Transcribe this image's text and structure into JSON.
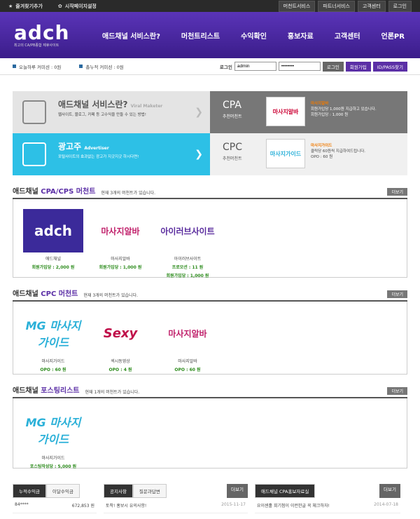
{
  "top": {
    "left": [
      "즐겨찾기추가",
      "시작페이지설정"
    ],
    "right": [
      "머천트서비스",
      "파트너서비스",
      "고객센터",
      "로그인"
    ]
  },
  "logo": {
    "name": "adch",
    "tag": "최고의 CA/PB종합 제휴사이트"
  },
  "menu": [
    "애드채널 서비스란?",
    "머천트리스트",
    "수익확인",
    "홍보자료",
    "고객센터",
    "언론PR"
  ],
  "login": {
    "stat1": "오늘하루 커미션 : 0원",
    "stat2": "총누적 커미션 : 0원",
    "label": "로그인",
    "id": "admin",
    "pw": "••••••••",
    "btn": "로그인",
    "join": "회원가입",
    "find": "ID/PASS찾기"
  },
  "banner": {
    "b1": {
      "title": "애드채널 서비스란?",
      "sub": "Viral Maketer",
      "desc": "웹사이트, 블로그, 카페 등 고수익을 만들 수 있는 방법!"
    },
    "b2": {
      "title": "CPA",
      "sub": "추천머천트",
      "name": "마사지알바",
      "line": "회원가입당 1,000원 지급하고 있습니다.",
      "val": "회원가입당 : 1,000 원"
    },
    "b3": {
      "title": "광고주",
      "sub": "Advertiser",
      "desc": "포털사이트의 효과없는 광고가 지긋지긋 하시다면!"
    },
    "b4": {
      "title": "CPC",
      "sub": "추천머천트",
      "name": "마사지가이드",
      "line": "클릭당 60원씩 지급하여드립니다.",
      "val": "OPO : 60 원"
    }
  },
  "sections": [
    {
      "pre": "애드채널",
      "hl": "CPA/CPS 머천트",
      "cnt": "현재 3개의 머천트가 있습니다.",
      "more": "더보기",
      "items": [
        {
          "img": "adch",
          "txt": "adch",
          "nm": "애드채널",
          "v": [
            "회원가입당 : 2,000 원"
          ]
        },
        {
          "img": "pink",
          "txt": "마사지알바",
          "nm": "마사지알바",
          "v": [
            "회원가입당 : 1,000 원"
          ]
        },
        {
          "img": "iner",
          "txt": "아이러브사이트",
          "nm": "아이러브사이트",
          "v": [
            "프로모션 : 11 원",
            "회원가입당 : 1,000 원"
          ]
        }
      ]
    },
    {
      "pre": "애드채널",
      "hl": "CPC 머천트",
      "cnt": "현재 3개의 머천트가 있습니다.",
      "more": "더보기",
      "items": [
        {
          "img": "mg",
          "txt": "MG 마사지가이드",
          "nm": "마사지가이드",
          "v": [
            "OPO : 60 원"
          ]
        },
        {
          "img": "sexy",
          "txt": "Sexy",
          "nm": "섹시동영상",
          "v": [
            "OPO : 4 원"
          ]
        },
        {
          "img": "pink",
          "txt": "마사지알바",
          "nm": "마사지알바",
          "v": [
            "OPO : 60 원"
          ]
        }
      ]
    },
    {
      "pre": "애드채널",
      "hl": "포스팅리스트",
      "cnt": "현재 1개의 머천트가 있습니다.",
      "more": "더보기",
      "items": [
        {
          "img": "mg",
          "txt": "MG 마사지가이드",
          "nm": "마사지가이드",
          "v": [
            "포스팅작성당 : 5,000 원"
          ]
        }
      ]
    }
  ],
  "bottom": {
    "t1": [
      "누적수익금",
      "이달수익금"
    ],
    "r1": [
      [
        "84****",
        "672,853 원"
      ]
    ],
    "t2": [
      "공지사항",
      "질문과답변"
    ],
    "r2": [
      [
        "토착! 홍보시 유의사항!",
        "2015-11-17"
      ]
    ],
    "t3": [
      "애드채널 CPA홍보자료실"
    ],
    "r3": [
      [
        "요이센홀 회기첨이 이런한글 꼭 체크하자!",
        "2014-07-18"
      ]
    ],
    "more": "더보기"
  }
}
